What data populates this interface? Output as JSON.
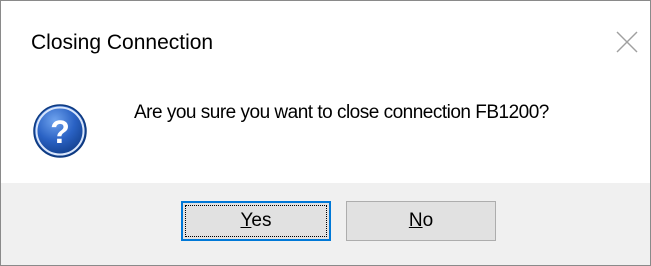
{
  "dialog": {
    "title": "Closing Connection",
    "message": "Are you sure you want to close connection FB1200?",
    "icon": "question-icon",
    "close_icon": "close-icon"
  },
  "buttons": {
    "yes": {
      "mnemonic": "Y",
      "rest": "es",
      "is_default": true
    },
    "no": {
      "mnemonic": "N",
      "rest": "o",
      "is_default": false
    }
  },
  "colors": {
    "accent": "#0078d7",
    "button_face": "#e1e1e1",
    "footer_bg": "#f0f0f0",
    "icon_blue": "#1f57b4"
  }
}
